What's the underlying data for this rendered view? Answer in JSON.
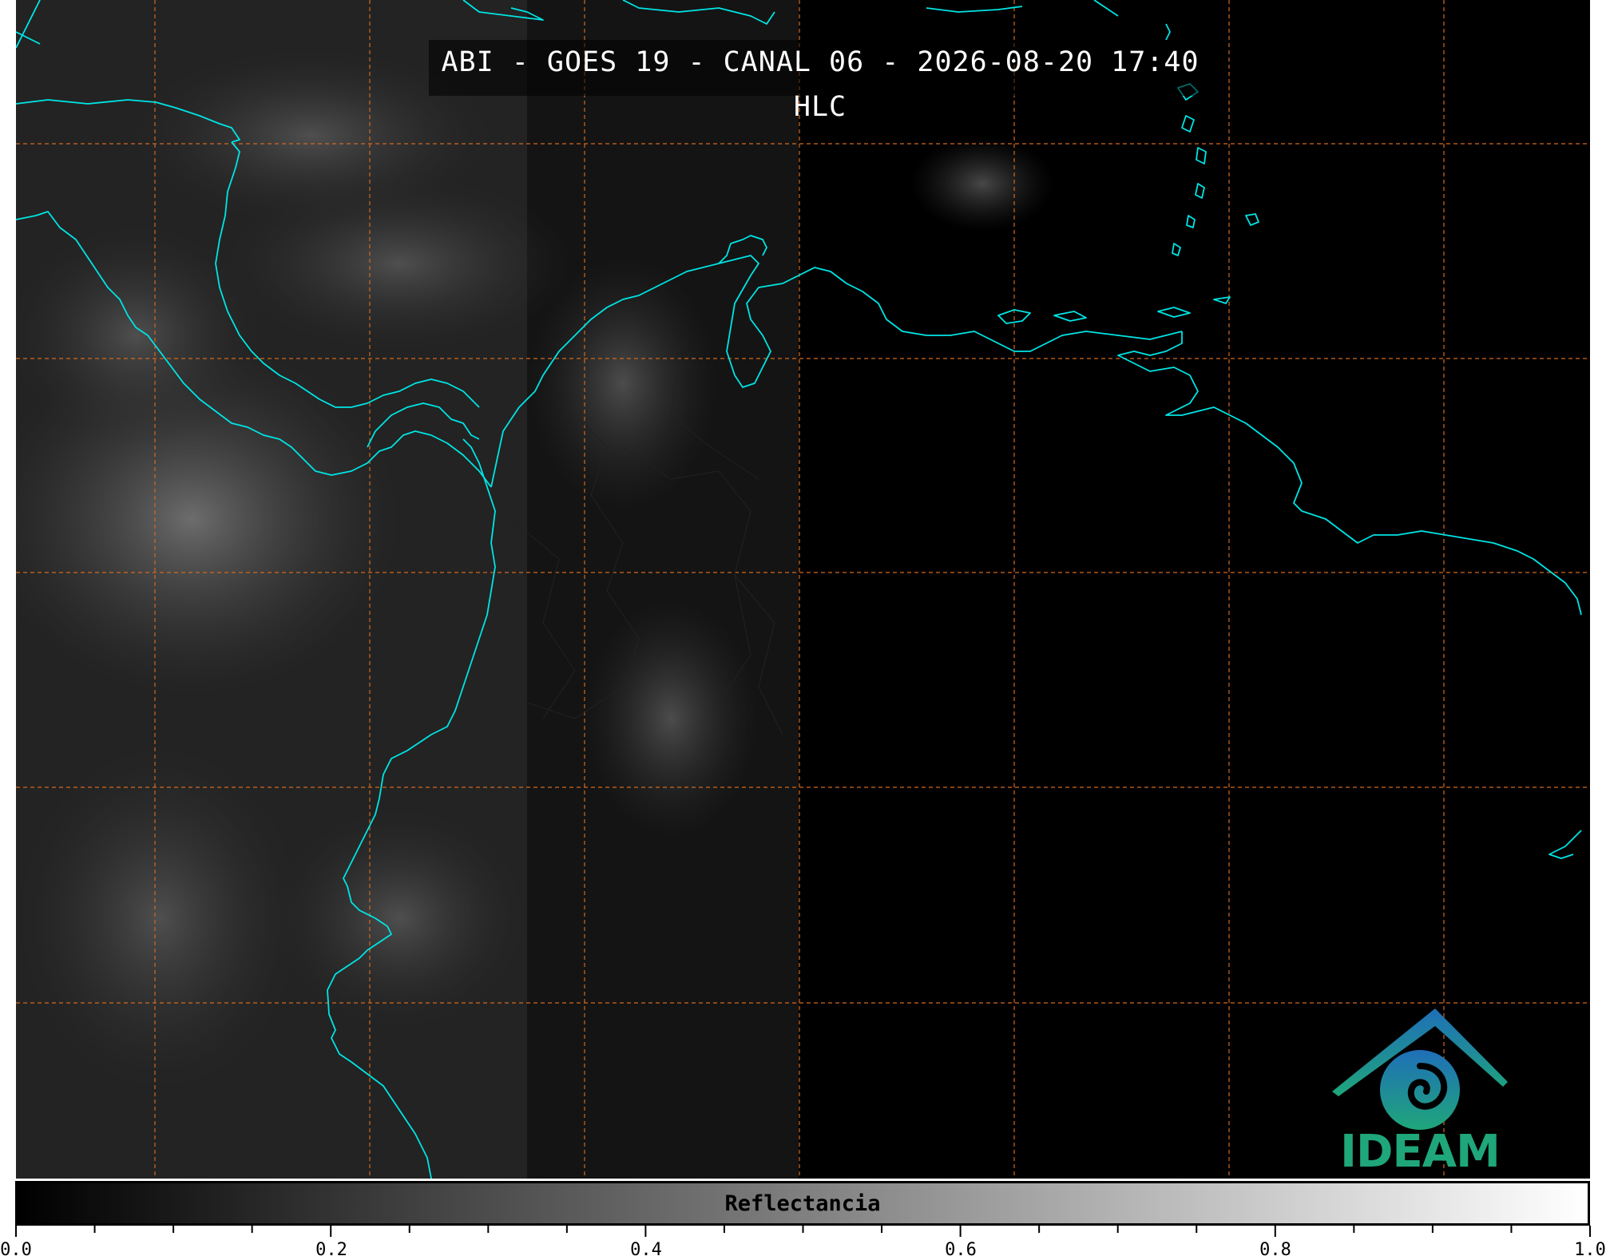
{
  "title": "ABI - GOES 19 - CANAL 06 - 2026-08-20 17:40 HLC",
  "logo": {
    "text": "IDEAM"
  },
  "colorbar": {
    "label": "Reflectancia",
    "range": [
      0.0,
      1.0
    ],
    "tick_labels": [
      "0.0",
      "0.2",
      "0.4",
      "0.6",
      "0.8",
      "1.0"
    ],
    "colors": {
      "low": "#000000",
      "high": "#ffffff"
    }
  },
  "map": {
    "coastline_color": "#00e5e5",
    "grid_color": "#d2691e",
    "background": "#000000"
  }
}
